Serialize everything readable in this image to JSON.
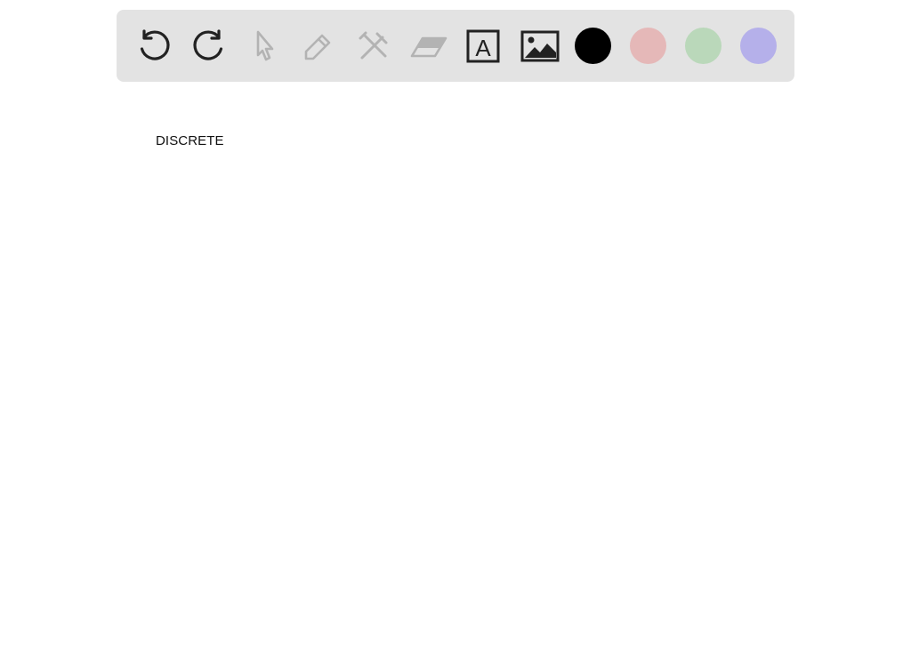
{
  "toolbar": {
    "tools": [
      {
        "icon": "undo-icon",
        "enabled": true
      },
      {
        "icon": "redo-icon",
        "enabled": true
      },
      {
        "icon": "pointer-icon",
        "enabled": false
      },
      {
        "icon": "pencil-icon",
        "enabled": false
      },
      {
        "icon": "tools-icon",
        "enabled": false
      },
      {
        "icon": "eraser-icon",
        "enabled": false
      },
      {
        "icon": "text-box-icon",
        "enabled": true
      },
      {
        "icon": "image-icon",
        "enabled": true
      }
    ],
    "text_tool_glyph": "A",
    "colors": {
      "black": "#000000",
      "pink": "#e5b8b8",
      "green": "#bad8ba",
      "purple": "#b5b0ea"
    },
    "active_icon_color": "#222222",
    "disabled_icon_color": "#b3b3b3"
  },
  "canvas": {
    "text_items": [
      "DISCRETE"
    ]
  }
}
